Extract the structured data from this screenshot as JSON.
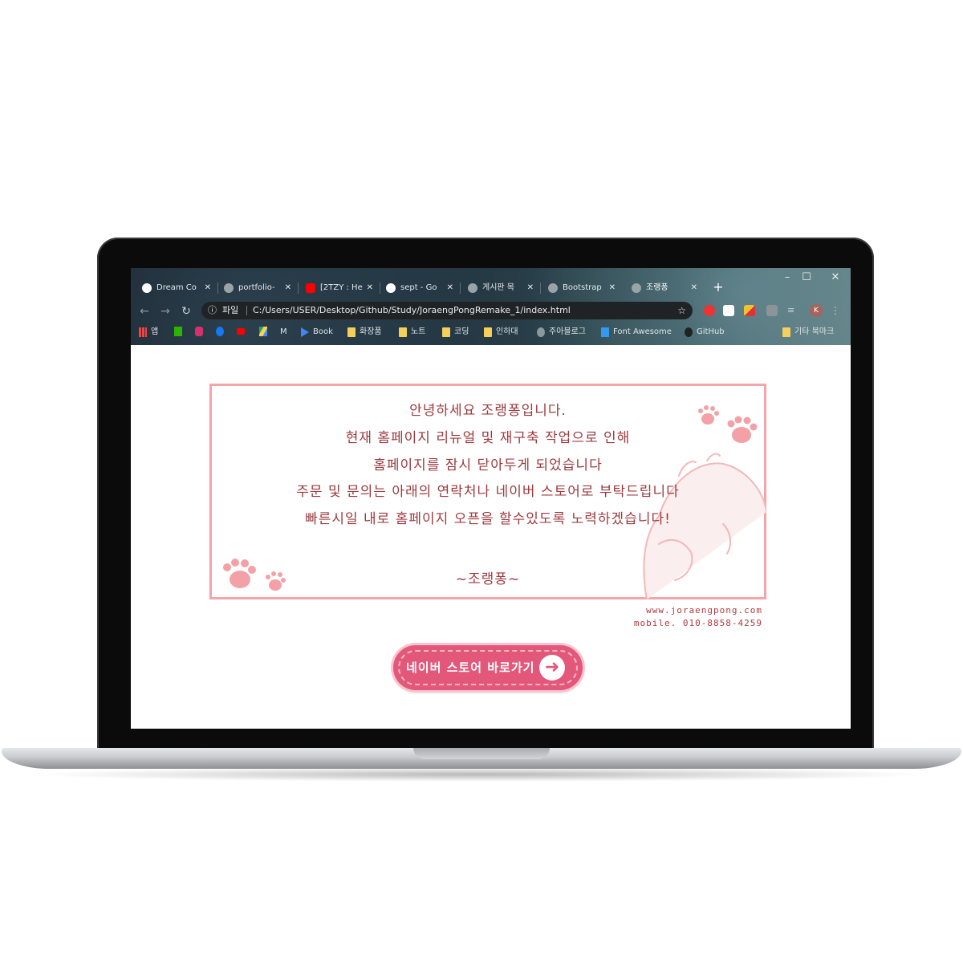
{
  "tabs": [
    {
      "label": "Dream Co",
      "favicon_color": "#ffffff"
    },
    {
      "label": "portfolio-",
      "favicon_color": "#9aa4a8"
    },
    {
      "label": "[2TZY : He",
      "favicon_color": "#ff0000"
    },
    {
      "label": "sept - Go",
      "favicon_color": "#ffffff"
    },
    {
      "label": "게시판 목",
      "favicon_color": "#9aa4a8"
    },
    {
      "label": "Bootstrap",
      "favicon_color": "#9aa4a8"
    },
    {
      "label": "조랭퐁",
      "favicon_color": "#9aa4a8"
    }
  ],
  "address": {
    "scheme_label": "파일",
    "url": "C:/Users/USER/Desktop/Github/Study/JoraengPongRemake_1/index.html"
  },
  "profile_initial": "K",
  "bookmarks": [
    {
      "label": "앱",
      "icon": "apps-grid-icon"
    },
    {
      "label": "",
      "icon": "naver-icon"
    },
    {
      "label": "",
      "icon": "instagram-icon"
    },
    {
      "label": "",
      "icon": "facebook-icon"
    },
    {
      "label": "",
      "icon": "youtube-icon"
    },
    {
      "label": "",
      "icon": "google-drive-icon"
    },
    {
      "label": "M",
      "icon": "gmail-icon"
    },
    {
      "label": "Book",
      "icon": "play-books-icon"
    },
    {
      "label": "화장품",
      "icon": "folder-icon"
    },
    {
      "label": "노트",
      "icon": "folder-icon"
    },
    {
      "label": "코딩",
      "icon": "folder-icon"
    },
    {
      "label": "인하대",
      "icon": "folder-icon"
    },
    {
      "label": "주아블로그",
      "icon": "globe-icon"
    },
    {
      "label": "Font Awesome",
      "icon": "flag-icon"
    },
    {
      "label": "GitHub",
      "icon": "github-icon"
    },
    {
      "label": "기타 북마크",
      "icon": "folder-icon"
    }
  ],
  "notice": {
    "lines": [
      "안녕하세요 조랭퐁입니다.",
      "현재 홈페이지 리뉴얼 및 재구축 작업으로 인해",
      "홈페이지를 잠시 닫아두게 되었습니다",
      "주문 및 문의는 아래의 연락처나 네이버 스토어로 부탁드립니다",
      "빠른시일 내로 홈페이지 오픈을 할수있도록 노력하겠습니다!"
    ],
    "signature": "~조랭퐁~"
  },
  "contact": {
    "website": "www.joraengpong.com",
    "mobile": "mobile. 010-8858-4259"
  },
  "store_button": {
    "label": "네이버 스토어 바로가기",
    "arrow": "➜"
  },
  "colors": {
    "accent_pink": "#e2577a",
    "border_pink": "#f5a4a9",
    "text_red": "#9c3a3f"
  }
}
